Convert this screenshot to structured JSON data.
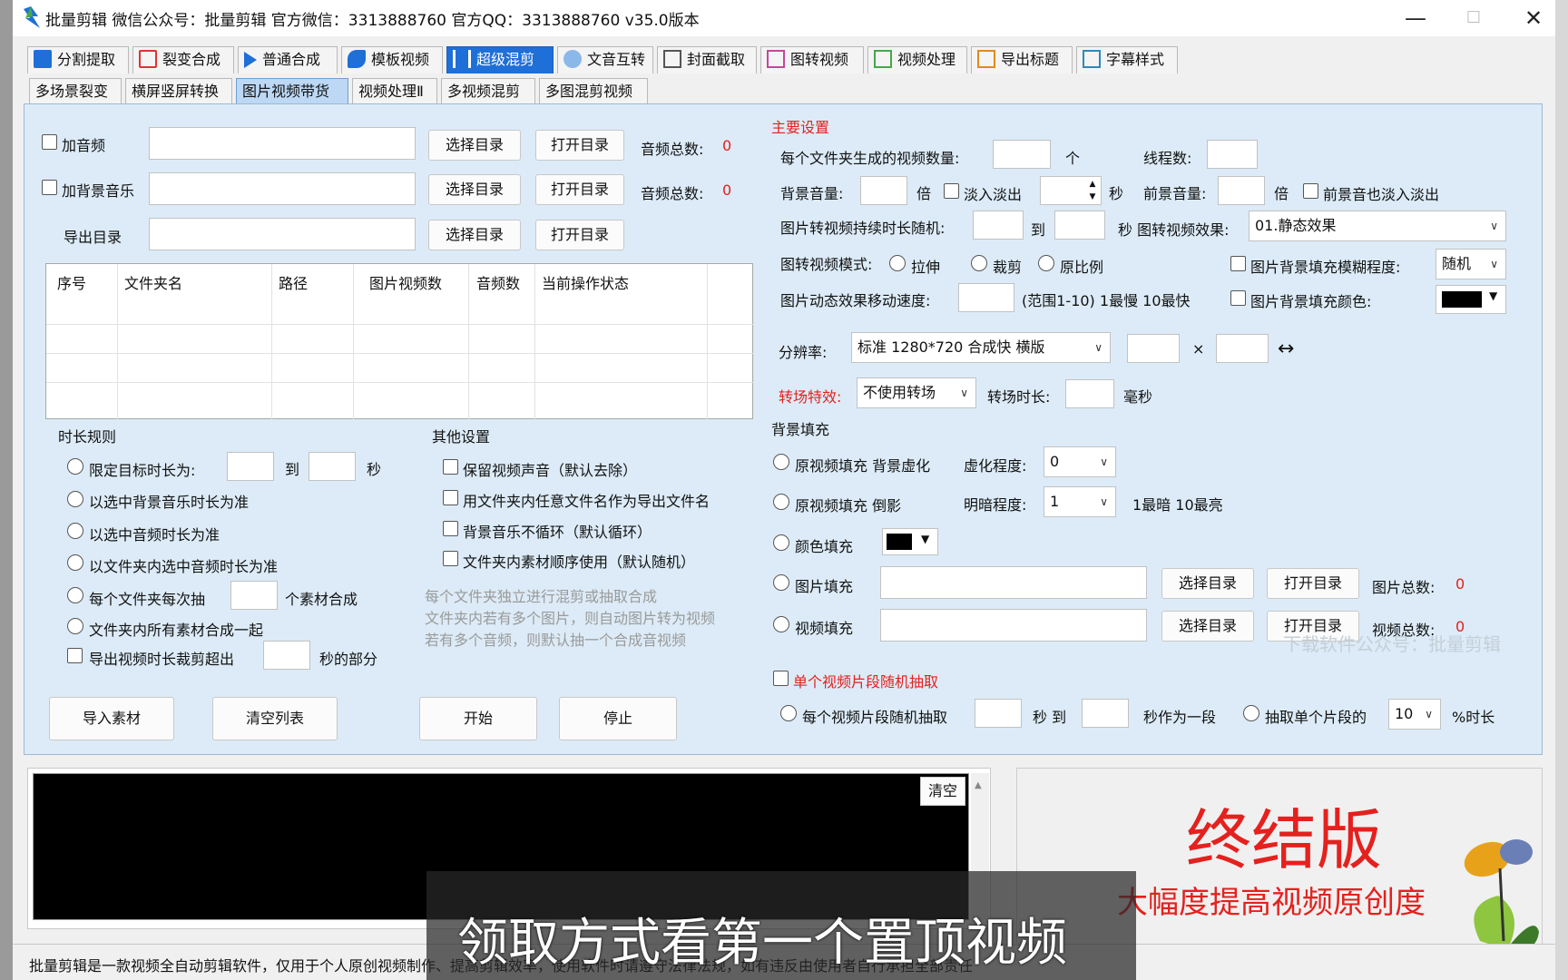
{
  "window": {
    "title": "批量剪辑 微信公众号：批量剪辑 官方微信：3313888760 官方QQ：3313888760 v35.0版本",
    "minimize": "—",
    "maximize": "☐",
    "close": "✕"
  },
  "main_tabs": [
    "分割提取",
    "裂变合成",
    "普通合成",
    "模板视频",
    "超级混剪",
    "文音互转",
    "封面截取",
    "图转视频",
    "视频处理",
    "导出标题",
    "字幕样式"
  ],
  "sub_tabs": [
    "多场景裂变",
    "横屏竖屏转换",
    "图片视频带货",
    "视频处理Ⅱ",
    "多视频混剪",
    "多图混剪视频"
  ],
  "left": {
    "add_audio": "加音频",
    "add_bgm": "加背景音乐",
    "export_dir": "导出目录",
    "select_dir": "选择目录",
    "open_dir": "打开目录",
    "audio_total": "音频总数:",
    "audio_total_value": "0",
    "bgm_total_value": "0",
    "grid_headers": [
      "序号",
      "文件夹名",
      "路径",
      "图片视频数",
      "音频数",
      "当前操作状态"
    ]
  },
  "duration": {
    "title": "时长规则",
    "limit": "限定目标时长为:",
    "to": "到",
    "sec": "秒",
    "bgm": "以选中背景音乐时长为准",
    "audio": "以选中音频时长为准",
    "folder_audio": "以文件夹内选中音频时长为准",
    "each_folder": "每个文件夹每次抽",
    "materials": "个素材合成",
    "all_materials": "文件夹内所有素材合成一起",
    "trim": "导出视频时长裁剪超出",
    "trim_suffix": "秒的部分"
  },
  "other": {
    "title": "其他设置",
    "keep_sound": "保留视频声音（默认去除）",
    "use_filename": "用文件夹内任意文件名作为导出文件名",
    "bgm_noloop": "背景音乐不循环（默认循环）",
    "order": "文件夹内素材顺序使用（默认随机）",
    "hint1": "每个文件夹独立进行混剪或抽取合成",
    "hint2": "文件夹内若有多个图片，则自动图片转为视频",
    "hint3": "若有多个音频，则默认抽一个合成音视频"
  },
  "buttons": {
    "import": "导入素材",
    "clear_list": "清空列表",
    "start": "开始",
    "stop": "停止",
    "clear": "清空"
  },
  "main_settings": {
    "title": "主要设置",
    "per_folder": "每个文件夹生成的视频数量:",
    "unit": "个",
    "threads": "线程数:",
    "bg_volume": "背景音量:",
    "times": "倍",
    "fade": "淡入淡出",
    "sec": "秒",
    "fg_volume": "前景音量:",
    "fg_fade": "前景音也淡入淡出",
    "img_duration": "图片转视频持续时长随机:",
    "to": "到",
    "img_effect_label": "秒 图转视频效果:",
    "img_effect_value": "01.静态效果",
    "mode_label": "图转视频模式:",
    "stretch": "拉伸",
    "crop": "裁剪",
    "original": "原比例",
    "blur_label": "图片背景填充模糊程度:",
    "blur_value": "随机",
    "speed_label": "图片动态效果移动速度:",
    "speed_range": "(范围1-10) 1最慢 10最快",
    "bg_color": "图片背景填充颜色:",
    "resolution_label": "分辨率:",
    "resolution_value": "标准 1280*720 合成快 横版",
    "x": "×",
    "swap": "↔",
    "transition_label": "转场特效:",
    "transition_value": "不使用转场",
    "transition_len": "转场时长:",
    "ms": "毫秒"
  },
  "bg_fill": {
    "title": "背景填充",
    "orig_blur": "原视频填充 背景虚化",
    "blur_degree": "虚化程度:",
    "blur_degree_value": "0",
    "orig_reflect": "原视频填充 倒影",
    "brightness": "明暗程度:",
    "brightness_value": "1",
    "brightness_hint": "1最暗 10最亮",
    "color_fill": "颜色填充",
    "image_fill": "图片填充",
    "video_fill": "视频填充",
    "select_dir": "选择目录",
    "open_dir": "打开目录",
    "img_total": "图片总数:",
    "img_total_value": "0",
    "video_total": "视频总数:",
    "video_total_value": "0",
    "watermark": "下载软件公众号：批量剪辑"
  },
  "segment": {
    "random_title": "单个视频片段随机抽取",
    "each_random": "每个视频片段随机抽取",
    "sec_to": "秒 到",
    "as_segment": "秒作为一段",
    "extract": "抽取单个片段的",
    "percent_value": "10",
    "percent": "%时长"
  },
  "promo": {
    "title": "终结版",
    "subtitle": "大幅度提高视频原创度"
  },
  "status_text": "批量剪辑是一款视频全自动剪辑软件，仅用于个人原创视频制作、提高剪辑效率，使用软件时请遵守法律法规，如有违反由使用者自行承担全部责任",
  "overlay_caption": "领取方式看第一个置顶视频",
  "colors": {
    "accent_blue": "#1e6fd8",
    "red": "#e4211e",
    "panel": "#dcebf7"
  }
}
